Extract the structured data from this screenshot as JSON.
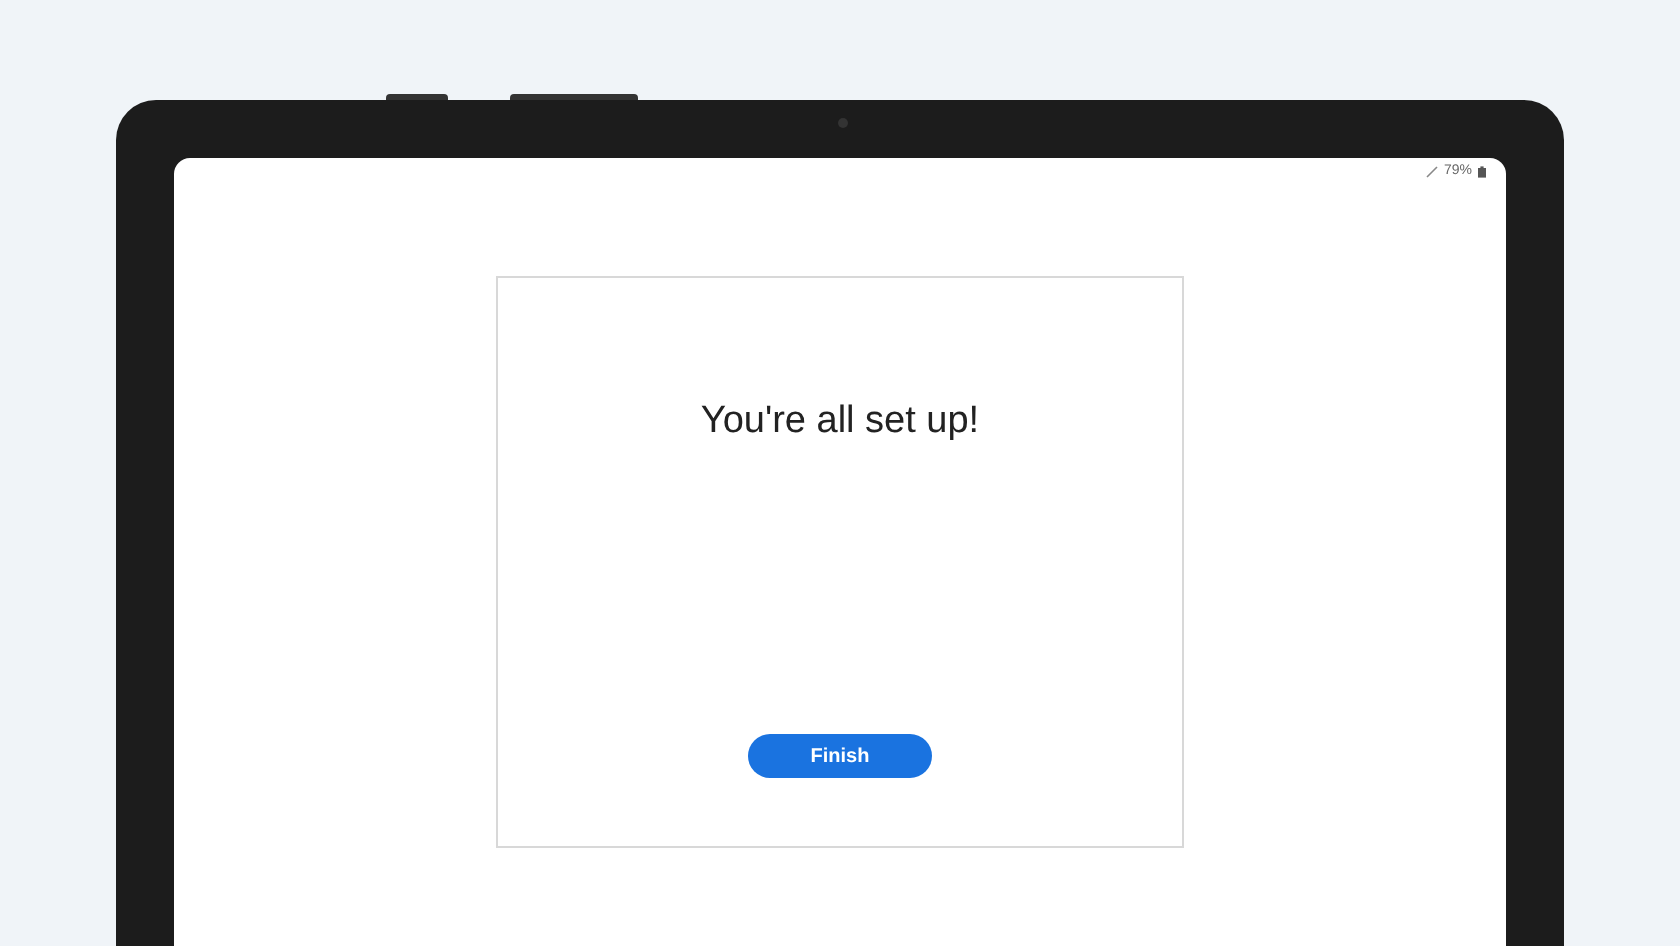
{
  "status_bar": {
    "battery": "79%"
  },
  "dialog": {
    "title": "You're all set up!",
    "button": "Finish"
  }
}
